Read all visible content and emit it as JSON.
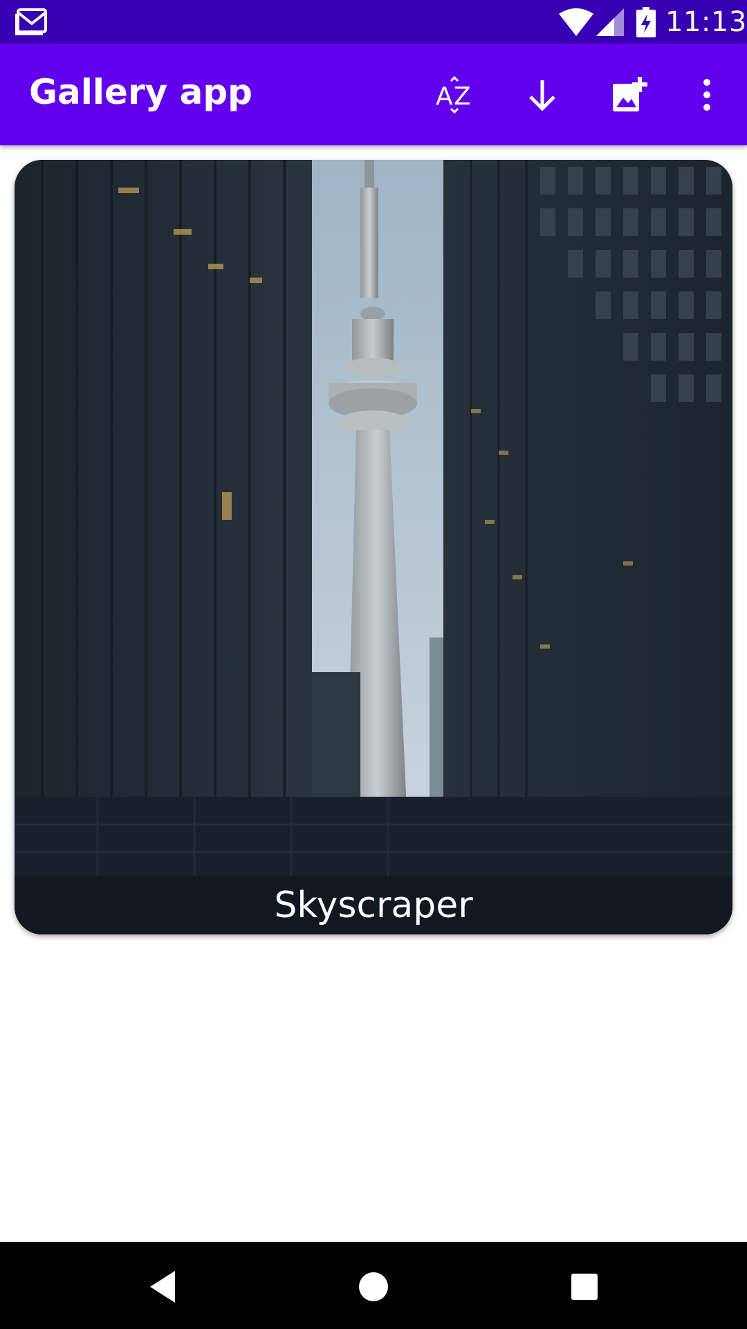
{
  "status_bar": {
    "time": "11:13",
    "icons": [
      "gmail-notification-icon",
      "wifi-icon",
      "cellular-signal-icon",
      "battery-charging-icon"
    ]
  },
  "app_bar": {
    "title": "Gallery app",
    "actions": [
      "sort-az-icon",
      "arrow-down-icon",
      "add-photo-icon",
      "more-vert-icon"
    ],
    "colors": {
      "status_bar": "#3700b3",
      "app_bar": "#6200ee"
    }
  },
  "gallery": {
    "items": [
      {
        "caption": "Skyscraper"
      }
    ]
  },
  "nav_bar": {
    "buttons": [
      "back-icon",
      "home-icon",
      "recents-icon"
    ]
  }
}
